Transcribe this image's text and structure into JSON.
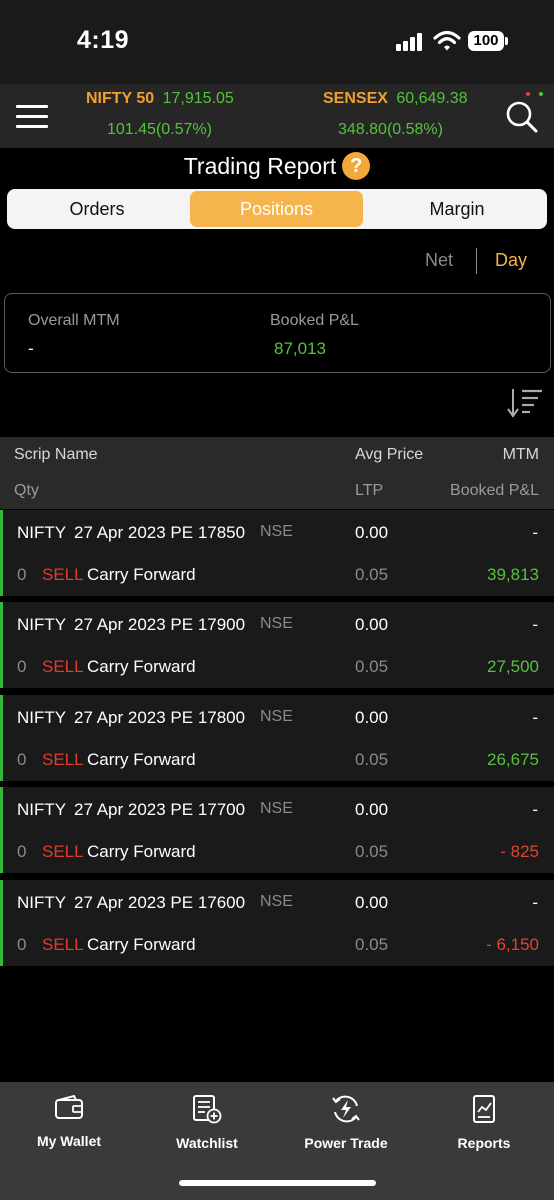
{
  "status": {
    "time": "4:19",
    "battery": "100"
  },
  "indices": [
    {
      "name": "NIFTY 50",
      "value": "17,915.05",
      "change": "101.45(0.57%)"
    },
    {
      "name": "SENSEX",
      "value": "60,649.38",
      "change": "348.80(0.58%)"
    }
  ],
  "header": {
    "title": "Trading Report",
    "help": "?"
  },
  "tabs": [
    {
      "label": "Orders",
      "active": false
    },
    {
      "label": "Positions",
      "active": true
    },
    {
      "label": "Margin",
      "active": false
    }
  ],
  "toggle": {
    "net": "Net",
    "day": "Day"
  },
  "summary": {
    "mtm_label": "Overall MTM",
    "mtm_value": "-",
    "booked_label": "Booked P&L",
    "booked_value": "87,013"
  },
  "table_header": {
    "scrip": "Scrip Name",
    "avg_price": "Avg Price",
    "mtm": "MTM",
    "qty": "Qty",
    "ltp": "LTP",
    "booked": "Booked P&L"
  },
  "positions": [
    {
      "symbol": "NIFTY",
      "contract": "27 Apr 2023 PE 17850",
      "exchange": "NSE",
      "avg_price": "0.00",
      "mtm": "-",
      "qty": "0",
      "side": "SELL",
      "product": "Carry Forward",
      "ltp": "0.05",
      "booked": "39,813",
      "booked_sign": "positive"
    },
    {
      "symbol": "NIFTY",
      "contract": "27 Apr 2023 PE 17900",
      "exchange": "NSE",
      "avg_price": "0.00",
      "mtm": "-",
      "qty": "0",
      "side": "SELL",
      "product": "Carry Forward",
      "ltp": "0.05",
      "booked": "27,500",
      "booked_sign": "positive"
    },
    {
      "symbol": "NIFTY",
      "contract": "27 Apr 2023 PE 17800",
      "exchange": "NSE",
      "avg_price": "0.00",
      "mtm": "-",
      "qty": "0",
      "side": "SELL",
      "product": "Carry Forward",
      "ltp": "0.05",
      "booked": "26,675",
      "booked_sign": "positive"
    },
    {
      "symbol": "NIFTY",
      "contract": "27 Apr 2023 PE 17700",
      "exchange": "NSE",
      "avg_price": "0.00",
      "mtm": "-",
      "qty": "0",
      "side": "SELL",
      "product": "Carry Forward",
      "ltp": "0.05",
      "booked": "- 825",
      "booked_sign": "negative"
    },
    {
      "symbol": "NIFTY",
      "contract": "27 Apr 2023 PE 17600",
      "exchange": "NSE",
      "avg_price": "0.00",
      "mtm": "-",
      "qty": "0",
      "side": "SELL",
      "product": "Carry Forward",
      "ltp": "0.05",
      "booked": "- 6,150",
      "booked_sign": "negative"
    }
  ],
  "bottom_nav": [
    {
      "label": "My Wallet",
      "icon": "wallet-icon"
    },
    {
      "label": "Watchlist",
      "icon": "watchlist-icon"
    },
    {
      "label": "Power Trade",
      "icon": "power-trade-icon"
    },
    {
      "label": "Reports",
      "icon": "reports-icon"
    }
  ],
  "colors": {
    "accent": "#f5b54c",
    "positive": "#54c23c",
    "negative": "#e0442f",
    "sell": "#e33a2d"
  }
}
